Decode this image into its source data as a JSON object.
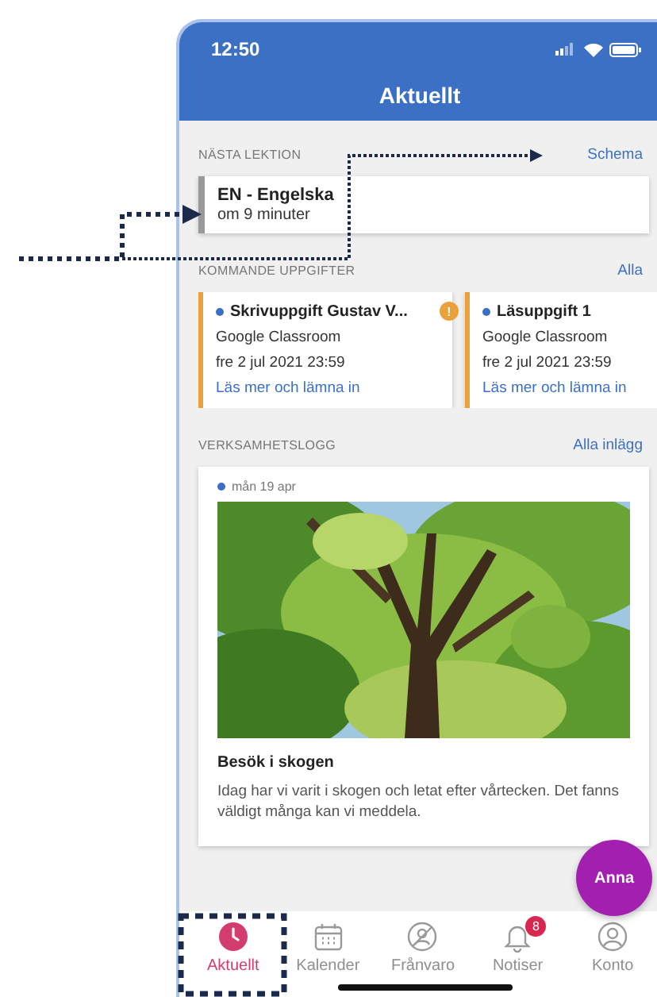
{
  "status_bar": {
    "time": "12:50"
  },
  "header": {
    "title": "Aktuellt"
  },
  "next_lesson": {
    "heading": "NÄSTA LEKTION",
    "link": "Schema",
    "lesson": {
      "title": "EN - Engelska",
      "subtitle": "om 9 minuter"
    }
  },
  "assignments": {
    "heading": "KOMMANDE UPPGIFTER",
    "link": "Alla",
    "items": [
      {
        "title": "Skrivuppgift Gustav V...",
        "source": "Google Classroom",
        "due": "fre 2 jul 2021 23:59",
        "link": "Läs mer och lämna in",
        "alert": "!"
      },
      {
        "title": "Läsuppgift 1",
        "source": "Google Classroom",
        "due": "fre 2 jul 2021 23:59",
        "link": "Läs mer och lämna in"
      }
    ]
  },
  "activity_log": {
    "heading": "VERKSAMHETSLOGG",
    "link": "Alla inlägg",
    "post": {
      "date": "mån 19 apr",
      "title": "Besök i skogen",
      "text": "Idag har vi varit i skogen och letat efter vårtecken. Det fanns väldigt många kan vi meddela."
    }
  },
  "fab": {
    "label": "Anna"
  },
  "tab_bar": [
    {
      "label": "Aktuellt",
      "kind": "clock",
      "selected": true
    },
    {
      "label": "Kalender",
      "kind": "calendar",
      "selected": false
    },
    {
      "label": "Frånvaro",
      "kind": "absence",
      "selected": false
    },
    {
      "label": "Notiser",
      "kind": "bell",
      "selected": false,
      "badge": "8"
    },
    {
      "label": "Konto",
      "kind": "person",
      "selected": false
    }
  ]
}
